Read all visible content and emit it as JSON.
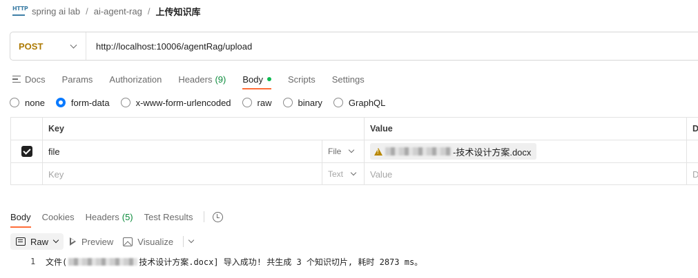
{
  "breadcrumb": {
    "icon_text": "HTTP",
    "items": [
      "spring ai lab",
      "ai-agent-rag"
    ],
    "separator": "/",
    "current": "上传知识库"
  },
  "request": {
    "method": "POST",
    "url": "http://localhost:10006/agentRag/upload"
  },
  "request_tabs": [
    {
      "label": "Docs"
    },
    {
      "label": "Params"
    },
    {
      "label": "Authorization"
    },
    {
      "label": "Headers",
      "count": "(9)"
    },
    {
      "label": "Body"
    },
    {
      "label": "Scripts"
    },
    {
      "label": "Settings"
    }
  ],
  "body_types": [
    "none",
    "form-data",
    "x-www-form-urlencoded",
    "raw",
    "binary",
    "GraphQL"
  ],
  "selected_body_type": "form-data",
  "params_table": {
    "headers": {
      "key": "Key",
      "value": "Value",
      "description": "D"
    },
    "rows": [
      {
        "checked": true,
        "key": "file",
        "type": "File",
        "value_suffix": "-技术设计方案.docx"
      }
    ],
    "placeholder": {
      "key": "Key",
      "type": "Text",
      "value": "Value",
      "description": "D"
    }
  },
  "response_tabs": [
    {
      "label": "Body"
    },
    {
      "label": "Cookies"
    },
    {
      "label": "Headers",
      "count": "(5)"
    },
    {
      "label": "Test Results"
    }
  ],
  "view_options": {
    "raw": "Raw",
    "preview": "Preview",
    "visualize": "Visualize"
  },
  "response_body": {
    "line_number": "1",
    "prefix": "文件(",
    "suffix": "技术设计方案.docx] 导入成功! 共生成 3 个知识切片, 耗时 2873 ms。"
  },
  "colors": {
    "method": "#ad7a03",
    "accent": "#ff6c37",
    "count_green": "#0a8a3a",
    "radio_selected": "#0a7aff",
    "http_icon": "#3d7ea6"
  }
}
